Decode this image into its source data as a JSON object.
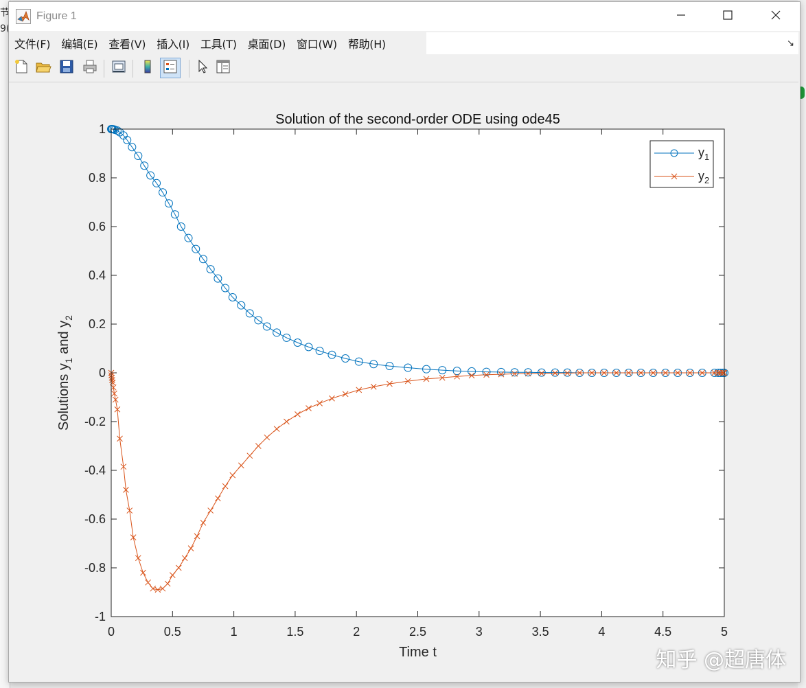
{
  "window": {
    "title": "Figure 1",
    "icon": "matlab-icon",
    "controls": [
      "minimize-icon",
      "maximize-icon",
      "close-icon"
    ]
  },
  "menubar": {
    "items": [
      "文件(F)",
      "编辑(E)",
      "查看(V)",
      "插入(I)",
      "工具(T)",
      "桌面(D)",
      "窗口(W)",
      "帮助(H)"
    ],
    "dock_icon": "↘"
  },
  "toolbar": {
    "buttons": [
      {
        "icon": "new-figure-icon"
      },
      {
        "icon": "open-file-icon"
      },
      {
        "icon": "save-icon"
      },
      {
        "icon": "print-icon"
      },
      {
        "icon": "link-plot-icon"
      },
      {
        "icon": "colorbar-icon"
      },
      {
        "icon": "legend-icon",
        "active": true
      },
      {
        "icon": "edit-plot-arrow-icon"
      },
      {
        "icon": "property-inspector-icon"
      }
    ]
  },
  "chart_data": {
    "type": "line",
    "title": "Solution of the second-order ODE using ode45",
    "xlabel": "Time t",
    "ylabel": "Solutions y1 and y2",
    "xlim": [
      0,
      5
    ],
    "ylim": [
      -1,
      1
    ],
    "xticks": [
      "0",
      "0.5",
      "1",
      "1.5",
      "2",
      "2.5",
      "3",
      "3.5",
      "4",
      "4.5",
      "5"
    ],
    "yticks": [
      "1",
      "0.8",
      "0.6",
      "0.4",
      "0.2",
      "0",
      "-0.2",
      "-0.4",
      "-0.6",
      "-0.8",
      "-1"
    ],
    "grid": false,
    "legend_position": "top-right",
    "series": [
      {
        "name": "y1",
        "color": "#0072BD",
        "marker": "circle",
        "x": [
          0,
          0.005,
          0.01,
          0.02,
          0.03,
          0.05,
          0.07,
          0.1,
          0.13,
          0.17,
          0.22,
          0.27,
          0.32,
          0.37,
          0.42,
          0.47,
          0.52,
          0.57,
          0.63,
          0.69,
          0.75,
          0.81,
          0.87,
          0.93,
          0.99,
          1.06,
          1.13,
          1.2,
          1.27,
          1.35,
          1.43,
          1.52,
          1.61,
          1.7,
          1.8,
          1.91,
          2.02,
          2.14,
          2.27,
          2.42,
          2.57,
          2.7,
          2.82,
          2.94,
          3.06,
          3.18,
          3.29,
          3.4,
          3.51,
          3.62,
          3.72,
          3.82,
          3.92,
          4.02,
          4.12,
          4.22,
          4.32,
          4.42,
          4.52,
          4.62,
          4.72,
          4.82,
          4.92,
          4.95,
          4.97,
          4.99,
          5.0
        ],
        "y": [
          1,
          1,
          1,
          0.999,
          0.997,
          0.994,
          0.987,
          0.974,
          0.955,
          0.926,
          0.89,
          0.85,
          0.81,
          0.778,
          0.74,
          0.695,
          0.65,
          0.6,
          0.553,
          0.508,
          0.467,
          0.425,
          0.387,
          0.348,
          0.31,
          0.277,
          0.244,
          0.216,
          0.19,
          0.165,
          0.144,
          0.124,
          0.106,
          0.09,
          0.074,
          0.059,
          0.046,
          0.036,
          0.028,
          0.021,
          0.015,
          0.011,
          0.008,
          0.006,
          0.004,
          0.003,
          0.002,
          0.002,
          0.001,
          0.001,
          0.001,
          0.0,
          0.0,
          0.0,
          0.0,
          0.0,
          0.0,
          0.0,
          0.0,
          0.0,
          0.0,
          0.0,
          0.0,
          0.0,
          0.0,
          0.0,
          0.0
        ]
      },
      {
        "name": "y2",
        "color": "#D95319",
        "marker": "x",
        "x": [
          0,
          0.002,
          0.005,
          0.008,
          0.012,
          0.018,
          0.025,
          0.035,
          0.05,
          0.07,
          0.1,
          0.12,
          0.15,
          0.18,
          0.22,
          0.26,
          0.3,
          0.34,
          0.38,
          0.42,
          0.46,
          0.5,
          0.55,
          0.6,
          0.65,
          0.7,
          0.75,
          0.81,
          0.87,
          0.93,
          0.99,
          1.06,
          1.13,
          1.2,
          1.27,
          1.35,
          1.43,
          1.52,
          1.61,
          1.7,
          1.8,
          1.91,
          2.02,
          2.14,
          2.27,
          2.42,
          2.57,
          2.7,
          2.82,
          2.94,
          3.06,
          3.18,
          3.29,
          3.4,
          3.51,
          3.62,
          3.72,
          3.82,
          3.92,
          4.02,
          4.12,
          4.22,
          4.32,
          4.42,
          4.52,
          4.62,
          4.72,
          4.82,
          4.92,
          4.95,
          4.97,
          4.99,
          5.0
        ],
        "y": [
          0,
          -0.01,
          -0.02,
          -0.03,
          -0.04,
          -0.06,
          -0.085,
          -0.11,
          -0.15,
          -0.27,
          -0.385,
          -0.48,
          -0.565,
          -0.675,
          -0.76,
          -0.82,
          -0.86,
          -0.885,
          -0.89,
          -0.885,
          -0.865,
          -0.83,
          -0.8,
          -0.76,
          -0.72,
          -0.67,
          -0.615,
          -0.565,
          -0.515,
          -0.465,
          -0.42,
          -0.38,
          -0.34,
          -0.3,
          -0.265,
          -0.23,
          -0.2,
          -0.17,
          -0.145,
          -0.125,
          -0.105,
          -0.087,
          -0.07,
          -0.057,
          -0.045,
          -0.034,
          -0.025,
          -0.02,
          -0.015,
          -0.011,
          -0.008,
          -0.006,
          -0.004,
          -0.003,
          -0.002,
          -0.001,
          -0.001,
          0.0,
          0.0,
          0.0,
          0.0,
          0.0,
          0.0,
          0.0,
          0.0,
          0.0,
          0.0,
          0.0,
          0.0,
          0.0,
          0.0,
          0.0,
          0.0
        ]
      }
    ],
    "legend": {
      "entries": [
        {
          "base": "y",
          "sub": "1"
        },
        {
          "base": "y",
          "sub": "2"
        }
      ]
    },
    "ylabel_parts": {
      "a": "Solutions y",
      "sub1": "1",
      "b": " and y",
      "sub2": "2"
    }
  },
  "watermark": {
    "text": "知乎 @超唐体"
  },
  "background": {
    "frag1": "节",
    "frag2": "9("
  }
}
